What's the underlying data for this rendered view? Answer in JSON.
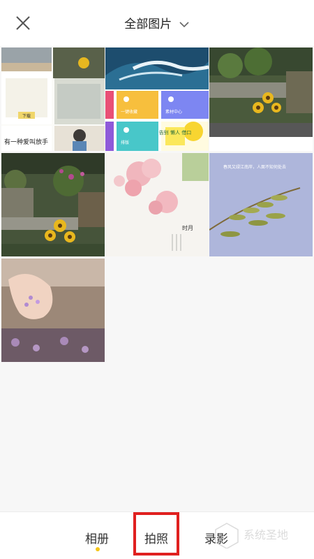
{
  "header": {
    "title": "全部图片",
    "close_icon": "close-icon",
    "dropdown_icon": "chevron-down-icon"
  },
  "photos": [
    {
      "name": "collage-screens",
      "thumb_text_1": "下载",
      "thumb_text_2": "有一种爱叫放手"
    },
    {
      "name": "ocean-wave"
    },
    {
      "name": "garden-sunflower-a"
    },
    {
      "name": "app-tiles",
      "tile_labels": [
        "一键收藏",
        "素材中心",
        "排版"
      ],
      "sticker_text": "告别\n懒人\n借口"
    },
    {
      "name": "garden-sunflower-b"
    },
    {
      "name": "cherry-blossom",
      "poem_text": "时月"
    },
    {
      "name": "willow-branch",
      "poem_text": "春风又绿江南岸，人面不知何处去"
    },
    {
      "name": "hand-petals"
    }
  ],
  "bottom_tabs": [
    {
      "label": "相册",
      "selected": true
    },
    {
      "label": "拍照",
      "highlighted": true
    },
    {
      "label": "录影"
    }
  ],
  "colors": {
    "accent_dot": "#f5c518",
    "highlight_red": "#e0201f"
  },
  "watermark_text": "系统圣地"
}
